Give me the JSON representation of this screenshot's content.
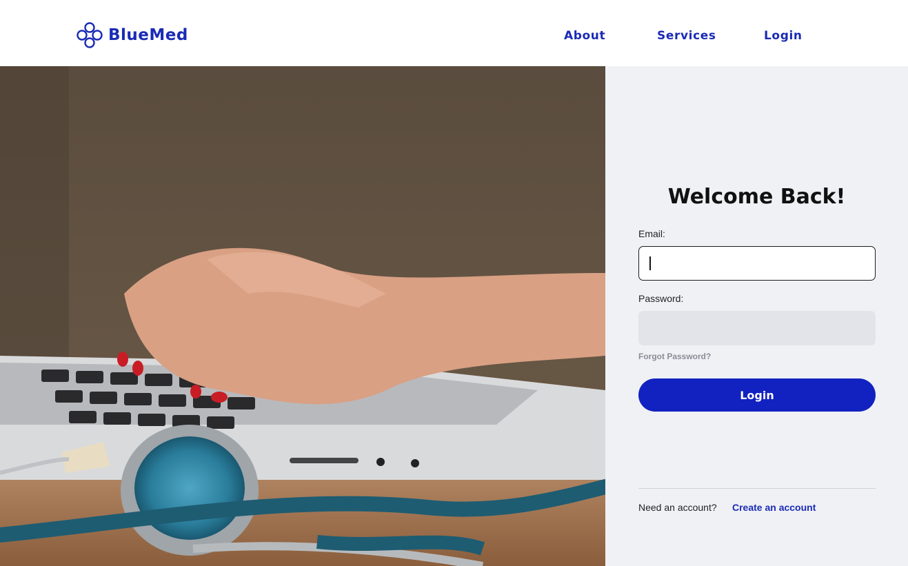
{
  "brand": {
    "name": "BlueMed",
    "color": "#1a2bb5"
  },
  "nav": {
    "about": "About",
    "services": "Services",
    "login": "Login"
  },
  "hero": {
    "icon": "laptop-stethoscope-photo"
  },
  "form": {
    "title": "Welcome Back!",
    "email_label": "Email:",
    "email_value": "",
    "password_label": "Password:",
    "password_value": "",
    "forgot": "Forgot Password?",
    "submit": "Login",
    "submit_color": "#1222c0"
  },
  "footer": {
    "prompt": "Need an account?",
    "create": "Create an account"
  }
}
